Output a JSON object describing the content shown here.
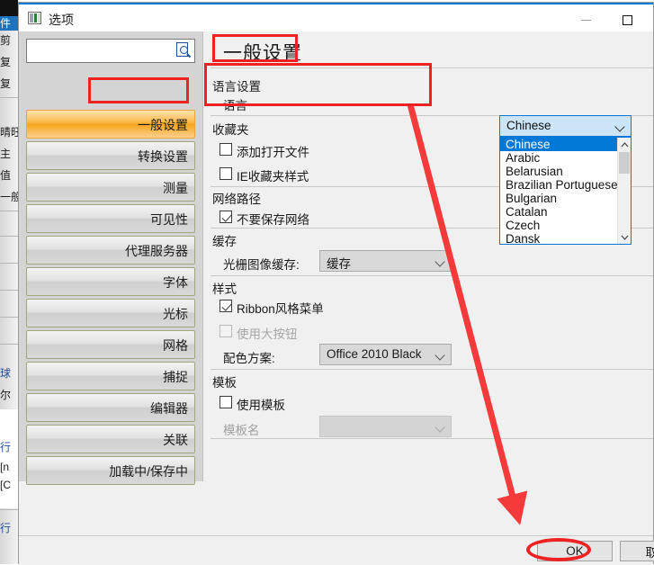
{
  "window": {
    "title": "选项",
    "icon": "options-window-icon",
    "minimize_label": "—",
    "maximize_label": "□",
    "close_label": "✕"
  },
  "sidebar": {
    "search": {
      "value": "",
      "placeholder": "",
      "icon": "search-icon"
    },
    "items": [
      {
        "label": "一般设置",
        "selected": true
      },
      {
        "label": "转换设置",
        "selected": false
      },
      {
        "label": "测量",
        "selected": false
      },
      {
        "label": "可见性",
        "selected": false
      },
      {
        "label": "代理服务器",
        "selected": false
      },
      {
        "label": "字体",
        "selected": false
      },
      {
        "label": "光标",
        "selected": false
      },
      {
        "label": "网格",
        "selected": false
      },
      {
        "label": "捕捉",
        "selected": false
      },
      {
        "label": "编辑器",
        "selected": false
      },
      {
        "label": "关联",
        "selected": false
      },
      {
        "label": "加载中/保存中",
        "selected": false
      }
    ]
  },
  "panel": {
    "title": "一般设置",
    "groups": {
      "language": {
        "heading": "语言设置",
        "field_label": "语言",
        "selected_value": "Chinese",
        "options": [
          "Chinese",
          "Arabic",
          "Belarusian",
          "Brazilian Portuguese",
          "Bulgarian",
          "Catalan",
          "Czech",
          "Dansk"
        ]
      },
      "favorites": {
        "heading": "收藏夹",
        "checkboxes": [
          {
            "label": "添加打开文件",
            "checked": false,
            "enabled": true
          },
          {
            "label": "IE收藏夹样式",
            "checked": false,
            "enabled": true
          }
        ]
      },
      "network": {
        "heading": "网络路径",
        "checkboxes": [
          {
            "label": "不要保存网络",
            "checked": true,
            "enabled": true
          }
        ]
      },
      "cache": {
        "heading": "缓存",
        "field_label": "光栅图像缓存:",
        "value": "缓存"
      },
      "style": {
        "heading": "样式",
        "checkboxes": [
          {
            "label": "Ribbon风格菜单",
            "checked": true,
            "enabled": true
          },
          {
            "label": "使用大按钮",
            "checked": false,
            "enabled": false
          }
        ],
        "scheme_label": "配色方案:",
        "scheme_value": "Office 2010 Black"
      },
      "template": {
        "heading": "模板",
        "checkboxes": [
          {
            "label": "使用模板",
            "checked": false,
            "enabled": true
          }
        ],
        "name_label": "模板名",
        "name_value": ""
      }
    }
  },
  "footer": {
    "ok_label": "OK",
    "cancel_label": "取消"
  },
  "annotations": {
    "accent_color": "#ee2222",
    "highlight_title": "一般设置",
    "highlight_sidebar_item": "一般设置",
    "highlight_language_group": "语言设置",
    "circled_button": "OK",
    "arrow": "points from language dropdown to OK button"
  },
  "background": {
    "fragments": [
      "件",
      "剪",
      "复",
      "复",
      "晴旺",
      "主",
      "值",
      "一般",
      "球",
      "尔",
      "行",
      "[n",
      "[C",
      "行"
    ]
  },
  "colors": {
    "title_accent": "#0078d7",
    "selected_sidebar": "#f7a51d",
    "dropdown_highlight": "#0078d7",
    "combobox_focus_bg": "#cce4f7",
    "dialog_bg": "#f0f0f0",
    "sidebar_bg": "#d4d4d4"
  }
}
